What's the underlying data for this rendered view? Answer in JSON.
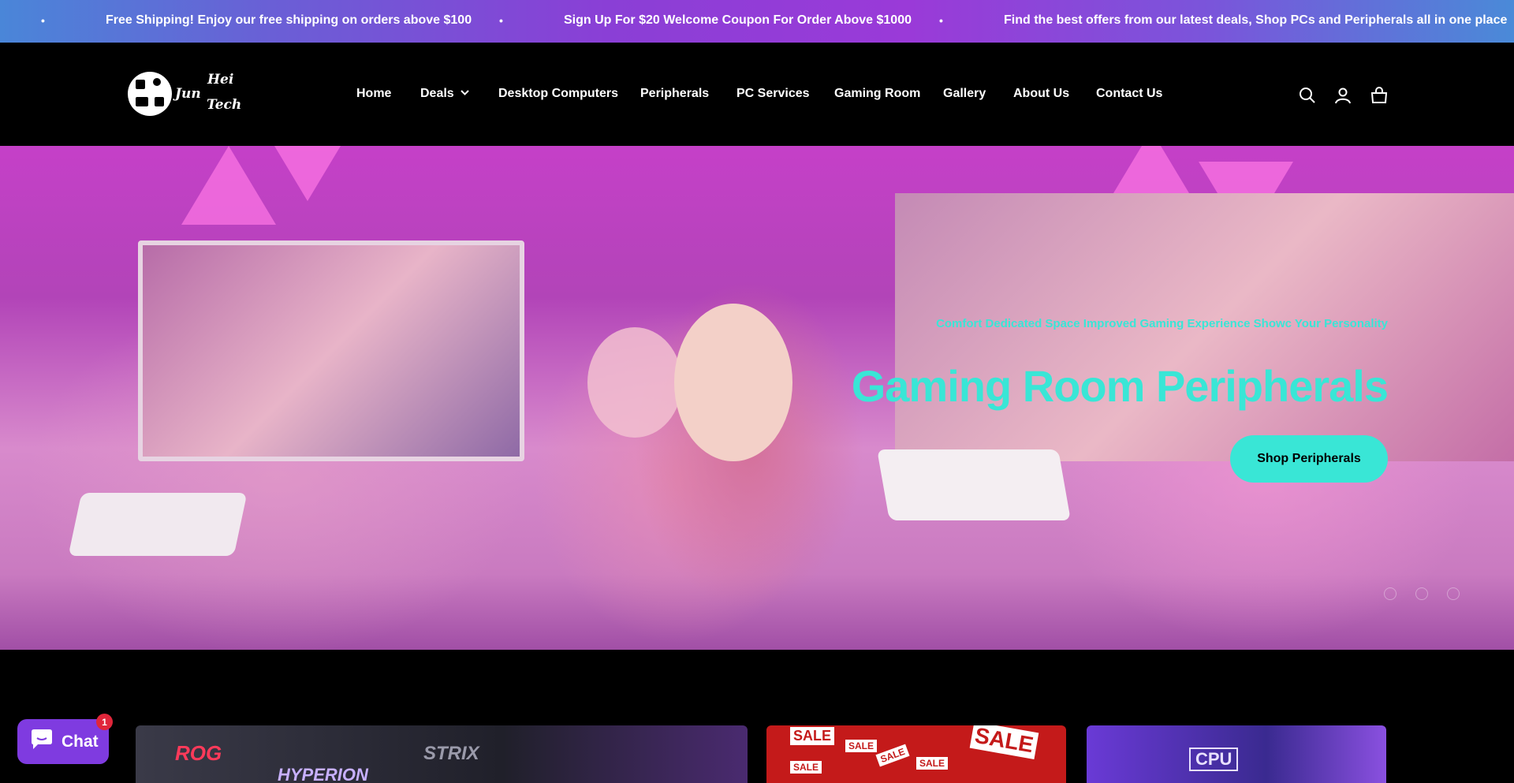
{
  "announcement": {
    "messages": [
      "Free Shipping! Enjoy our free shipping on orders above $100",
      "Sign Up For $20 Welcome Coupon For Order Above $1000",
      "Find the best offers from our latest deals, Shop PCs and Peripherals all in one place"
    ],
    "separator": "•"
  },
  "header": {
    "logo_line1": "Hei",
    "logo_line2": "Jun",
    "logo_line3": "Tech",
    "nav": [
      "Home",
      "Deals",
      "Desktop Computers",
      "Peripherals",
      "PC Services",
      "Gaming Room",
      "Gallery",
      "About Us",
      "Contact Us"
    ],
    "deals_chevron": "⌄",
    "icons": [
      "search-icon",
      "account-icon",
      "cart-icon"
    ]
  },
  "hero": {
    "eyebrow": "Comfort Dedicated Space  Improved Gaming Experience  Showc Your Personality",
    "title": "Gaming Room Peripherals",
    "button": "Shop Peripherals",
    "accent_color": "#39e6d6"
  },
  "tiles": {
    "tile1_brand": "ROG",
    "tile1_text1": "STRIX",
    "tile1_text2": "HYPERION",
    "tile2_sale": "SALE",
    "tile3_text": "CPU"
  },
  "chat": {
    "label": "Chat",
    "badge": "1"
  }
}
